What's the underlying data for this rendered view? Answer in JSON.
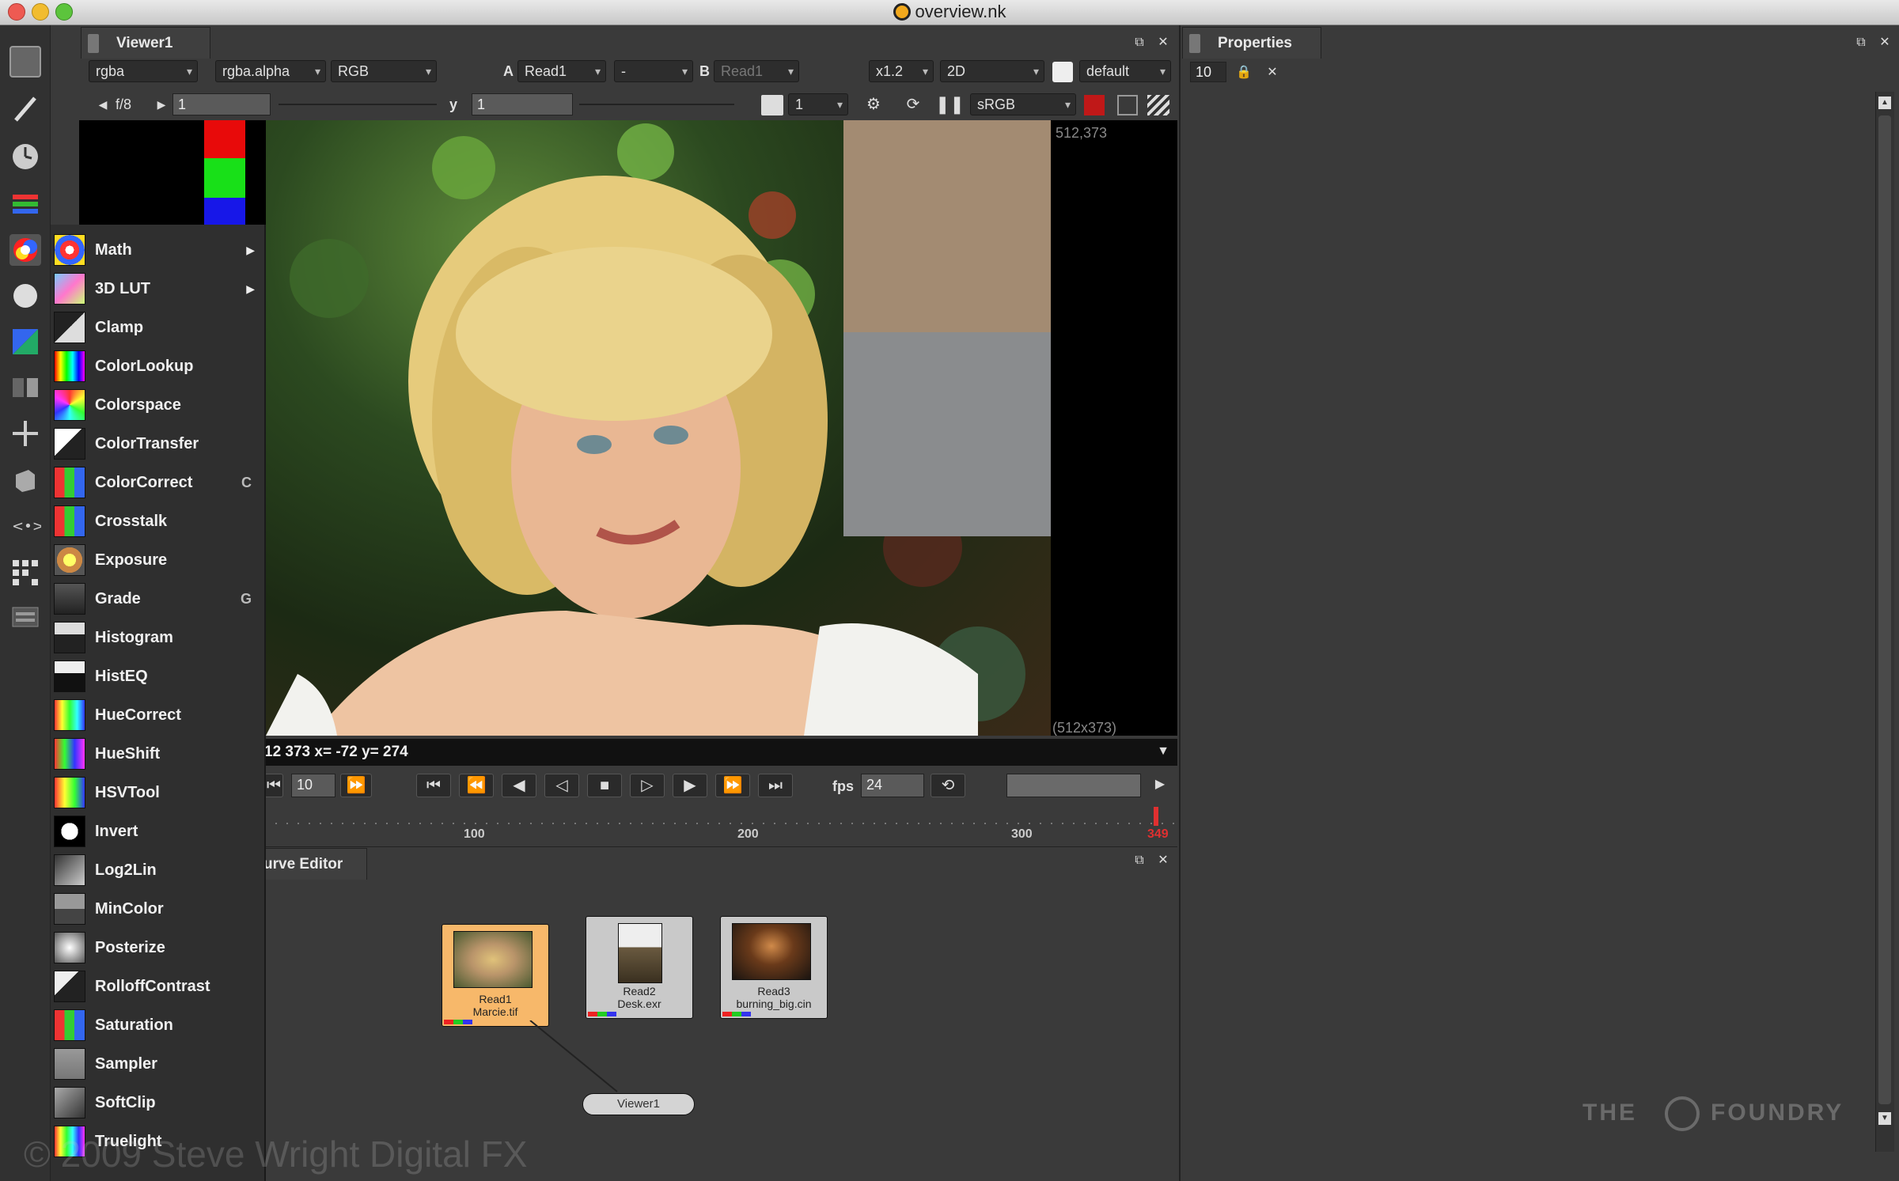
{
  "window": {
    "title": "overview.nk"
  },
  "viewer": {
    "tab_label": "Viewer1",
    "channels": "rgba",
    "alpha_channel": "rgba.alpha",
    "display_channels": "RGB",
    "a_label": "A",
    "input_a": "Read1",
    "wipe_op": "-",
    "b_label": "B",
    "input_b": "Read1",
    "zoom": "x1.2",
    "view_mode": "2D",
    "lut_default": "default",
    "fstop": "f/8",
    "gain_value": "1",
    "gamma_label": "y",
    "gamma_value": "1",
    "proxy_value": "1",
    "colorspace": "sRGB",
    "format_top_right": "512,373",
    "format_bottom_right": "(512x373)",
    "info_bar": "12 373  x= -72 y= 274"
  },
  "playback": {
    "frame_value": "10",
    "fps_label": "fps",
    "fps_value": "24",
    "ticks": [
      "100",
      "200",
      "300",
      "349"
    ],
    "current_frame_marker": "349"
  },
  "properties": {
    "tab_label": "Properties",
    "max_panels_value": "10"
  },
  "node_graph": {
    "tab_label": "urve Editor",
    "nodes": [
      {
        "line1": "Read1",
        "line2": "Marcie.tif"
      },
      {
        "line1": "Read2",
        "line2": "Desk.exr"
      },
      {
        "line1": "Read3",
        "line2": "burning_big.cin"
      }
    ],
    "viewer_node": "Viewer1"
  },
  "color_menu": {
    "items": [
      {
        "label": "Math",
        "submenu": true,
        "hotkey": ""
      },
      {
        "label": "3D LUT",
        "submenu": true,
        "hotkey": ""
      },
      {
        "label": "Clamp",
        "submenu": false,
        "hotkey": ""
      },
      {
        "label": "ColorLookup",
        "submenu": false,
        "hotkey": ""
      },
      {
        "label": "Colorspace",
        "submenu": false,
        "hotkey": ""
      },
      {
        "label": "ColorTransfer",
        "submenu": false,
        "hotkey": ""
      },
      {
        "label": "ColorCorrect",
        "submenu": false,
        "hotkey": "C"
      },
      {
        "label": "Crosstalk",
        "submenu": false,
        "hotkey": ""
      },
      {
        "label": "Exposure",
        "submenu": false,
        "hotkey": ""
      },
      {
        "label": "Grade",
        "submenu": false,
        "hotkey": "G"
      },
      {
        "label": "Histogram",
        "submenu": false,
        "hotkey": ""
      },
      {
        "label": "HistEQ",
        "submenu": false,
        "hotkey": ""
      },
      {
        "label": "HueCorrect",
        "submenu": false,
        "hotkey": ""
      },
      {
        "label": "HueShift",
        "submenu": false,
        "hotkey": ""
      },
      {
        "label": "HSVTool",
        "submenu": false,
        "hotkey": ""
      },
      {
        "label": "Invert",
        "submenu": false,
        "hotkey": ""
      },
      {
        "label": "Log2Lin",
        "submenu": false,
        "hotkey": ""
      },
      {
        "label": "MinColor",
        "submenu": false,
        "hotkey": ""
      },
      {
        "label": "Posterize",
        "submenu": false,
        "hotkey": ""
      },
      {
        "label": "RolloffContrast",
        "submenu": false,
        "hotkey": ""
      },
      {
        "label": "Saturation",
        "submenu": false,
        "hotkey": ""
      },
      {
        "label": "Sampler",
        "submenu": false,
        "hotkey": ""
      },
      {
        "label": "SoftClip",
        "submenu": false,
        "hotkey": ""
      },
      {
        "label": "Truelight",
        "submenu": false,
        "hotkey": ""
      }
    ]
  },
  "watermark": "© 2009 Steve Wright Digital FX",
  "logo_text": {
    "left": "THE",
    "right": "FOUNDRY"
  },
  "colors": {
    "accent_red": "#e0201c",
    "node_selected": "#f7b86a",
    "panel_bg": "#3a3a3a"
  }
}
